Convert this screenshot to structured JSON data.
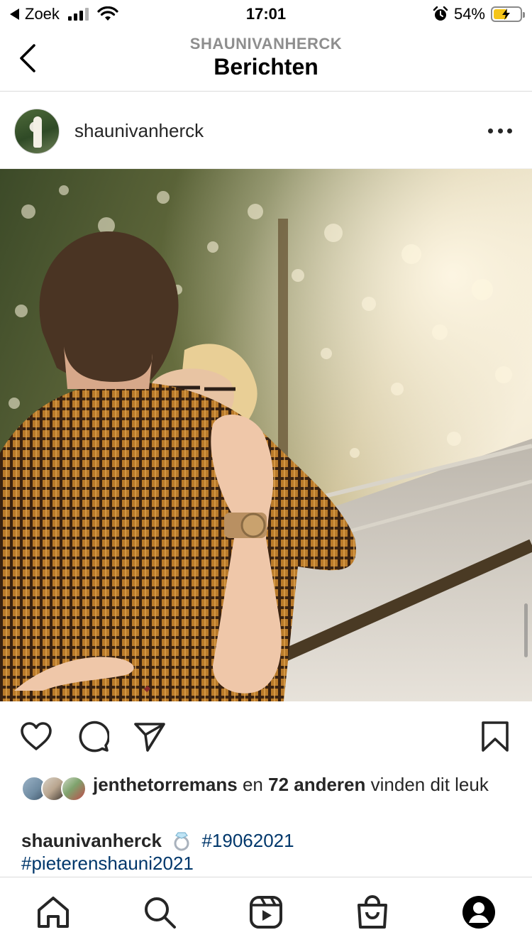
{
  "status_bar": {
    "back_app": "Zoek",
    "time": "17:01",
    "battery": "54%",
    "battery_level": 0.54
  },
  "header": {
    "subtitle": "SHAUNIVANHERCK",
    "title": "Berichten"
  },
  "post": {
    "username": "shaunivanherck",
    "likes": {
      "first_liker": "jenthetorremans",
      "connector": " en ",
      "others_count": "72 anderen",
      "suffix": " vinden dit leuk"
    },
    "caption": {
      "username": "shaunivanherck",
      "emoji": "ring-icon",
      "hashtags": [
        "#19062021",
        "#pieterenshauni2021"
      ]
    }
  },
  "icons": {
    "back": "chevron-left-icon",
    "more": "more-horizontal-icon",
    "like": "heart-icon",
    "comment": "comment-icon",
    "share": "paper-plane-icon",
    "save": "bookmark-icon",
    "nav": [
      "home-icon",
      "search-icon",
      "reels-icon",
      "shop-icon",
      "profile-icon"
    ]
  },
  "colors": {
    "hashtag": "#00376b",
    "text": "#262626",
    "muted": "#8e8e8e",
    "battery": "#f5c518"
  }
}
